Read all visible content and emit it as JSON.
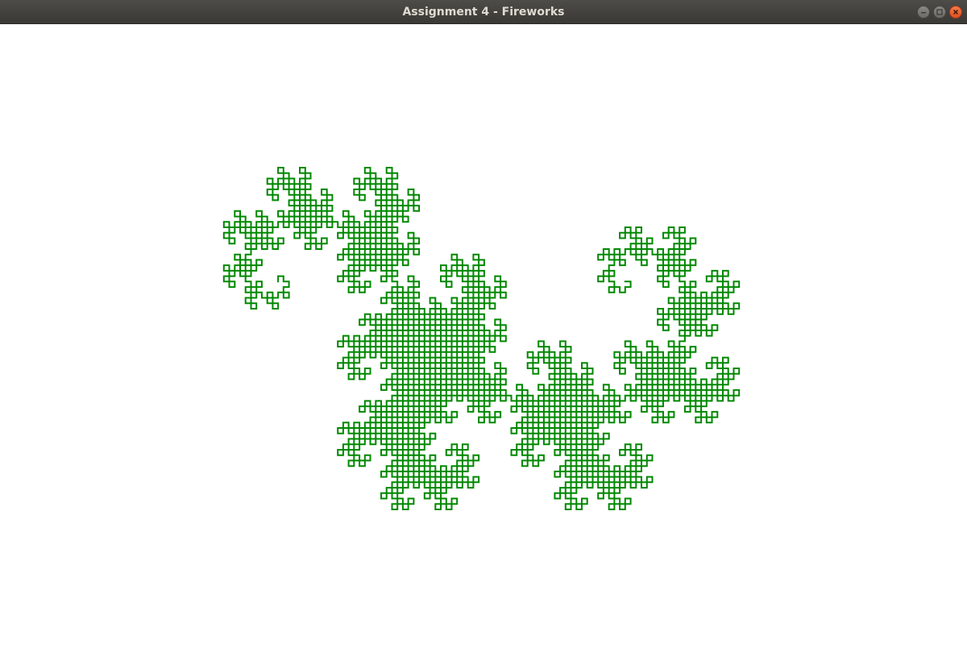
{
  "window": {
    "title": "Assignment 4 - Fireworks",
    "controls": [
      {
        "name": "minimize-button",
        "icon": "minimize-icon"
      },
      {
        "name": "maximize-button",
        "icon": "maximize-icon"
      },
      {
        "name": "close-button",
        "icon": "close-icon"
      }
    ]
  },
  "canvas": {
    "background": "#ffffff",
    "figure": "dragon-curve",
    "stroke_color": "#008800",
    "iterations": 12
  }
}
